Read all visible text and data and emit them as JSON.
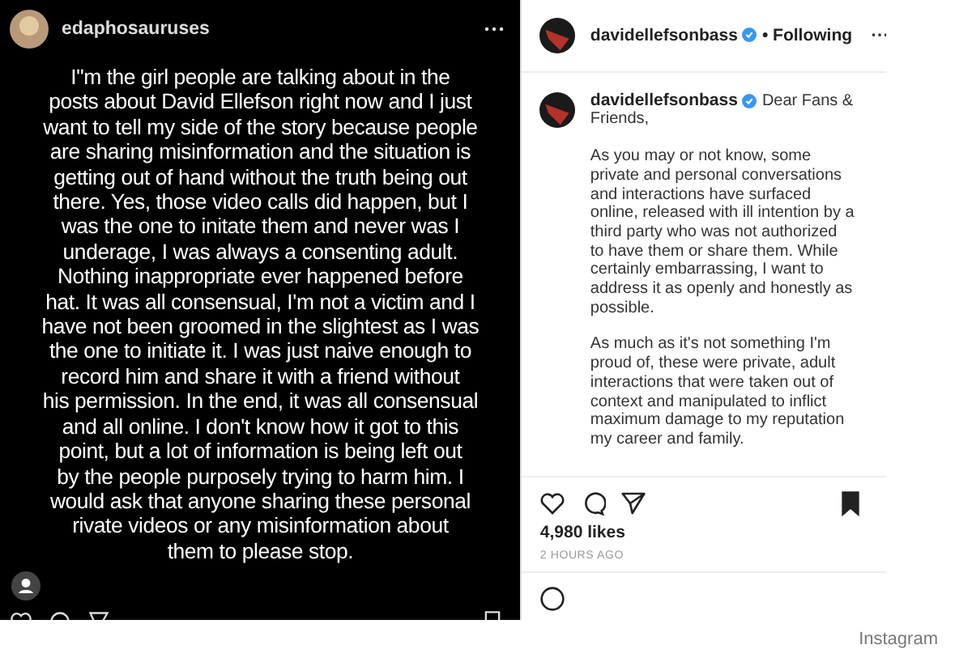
{
  "left_post": {
    "username": "edaphosauruses",
    "text": "I\"m the girl people are talking about in the\nposts about David Ellefson right now and I just\nwant to tell my side of the story because people\nare sharing misinformation and the situation is\ngetting out of hand without the truth being out\nthere. Yes, those video calls did happen, but I\nwas the one to initate them and never was I\nunderage, I was always a consenting adult.\nNothing inappropriate ever happened before\nhat. It was all consensual, I'm not a victim and I\nhave not been groomed in the slightest as I was\nthe one to initiate it. I was just naive enough to\nrecord him and share it with a friend without\nhis permission. In the end, it was all consensual\nand all online. I don't know how it got to this\npoint, but a lot of information is being left out\nby the people purposely trying to harm him. I\nwould ask that anyone sharing these personal\nrivate videos or any misinformation about\nthem to please stop.",
    "tagged_people": true
  },
  "right_post": {
    "header": {
      "username": "davidellefsonbass",
      "verified": true,
      "follow_status": "• Following"
    },
    "caption": {
      "username": "davidellefsonbass",
      "verified": true,
      "opening": "Dear Fans &\nFriends,",
      "paragraphs": [
        "As you may or not know, some\nprivate and personal conversations\nand interactions have surfaced\nonline, released with ill intention by a\nthird party who was not authorized\nto have them or share them. While\ncertainly embarrassing, I want to\naddress it as openly and honestly as\npossible.",
        "As much as it's not something I'm\nproud of, these were private, adult\ninteractions that were taken out of\ncontext and manipulated to inflict\nmaximum damage to my reputation\nmy career and family."
      ]
    },
    "liked": false,
    "saved": true,
    "likes": "4,980 likes",
    "time": "2 HOURS AGO"
  },
  "credit": "Instagram"
}
